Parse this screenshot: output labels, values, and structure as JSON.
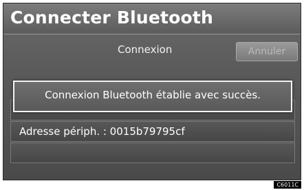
{
  "screen": {
    "title": "Connecter Bluetooth",
    "subheader": "Connexion",
    "cancel_label": "Annuler"
  },
  "dialog": {
    "message": "Connexion Bluetooth établie avec succès."
  },
  "list": {
    "rows": [
      {
        "text": ""
      },
      {
        "text": "Adresse périph. : 0015b79795cf"
      },
      {
        "text": ""
      }
    ]
  },
  "figure_code": "C6011C"
}
